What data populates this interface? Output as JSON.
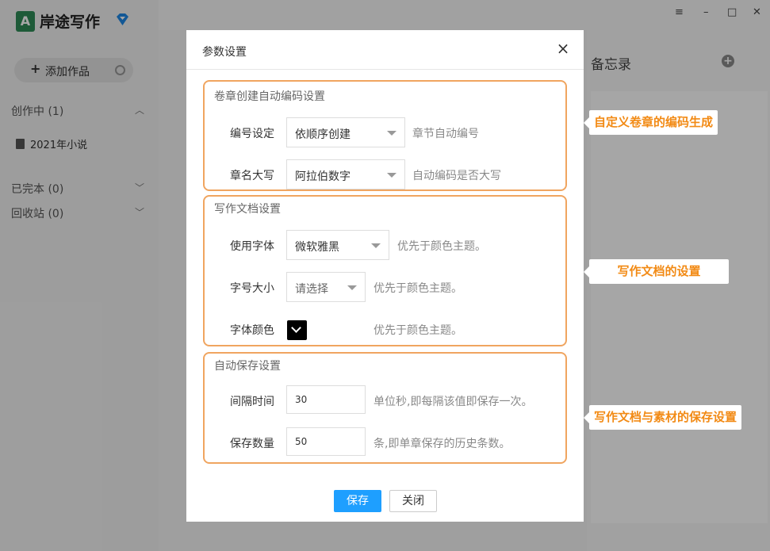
{
  "app": {
    "name": "岸途写作",
    "logo_glyph": "A",
    "add_work_label": "添加作品",
    "groups": [
      {
        "label": "创作中 (1)"
      },
      {
        "label": "已完本 (0)"
      },
      {
        "label": "回收站 (0)"
      }
    ],
    "book_item": "2021年小说",
    "memo_title": "备忘录",
    "window_controls": [
      "≡",
      "–",
      "□",
      "✕"
    ]
  },
  "dialog": {
    "title": "参数设置",
    "close_icon": "×",
    "sections": {
      "chapter": {
        "title": "卷章创建自动编码设置",
        "numbering": {
          "label": "编号设定",
          "value": "依顺序创建",
          "hint": "章节自动编号"
        },
        "capital": {
          "label": "章名大写",
          "value": "阿拉伯数字",
          "hint": "自动编码是否大写"
        }
      },
      "document": {
        "title": "写作文档设置",
        "font": {
          "label": "使用字体",
          "value": "微软雅黑",
          "hint": "优先于颜色主题。"
        },
        "size": {
          "label": "字号大小",
          "value": "请选择",
          "hint": "优先于颜色主题。"
        },
        "color": {
          "label": "字体颜色",
          "value": "#000000",
          "hint": "优先于颜色主题。"
        }
      },
      "autosave": {
        "title": "自动保存设置",
        "interval": {
          "label": "间隔时间",
          "value": "30",
          "hint": "单位秒,即每隔该值即保存一次。"
        },
        "count": {
          "label": "保存数量",
          "value": "50",
          "hint": "条,即单章保存的历史条数。"
        }
      }
    },
    "save_label": "保存",
    "close_label": "关闭"
  },
  "callouts": {
    "chapter": "自定义卷章的编码生成",
    "document": "写作文档的设置",
    "autosave": "写作文档与素材的保存设置"
  },
  "colors": {
    "accent_orange": "#f0a560",
    "callout_text": "#f28a14",
    "primary_button": "#1e9fff",
    "brand_green": "#2e8b57"
  }
}
